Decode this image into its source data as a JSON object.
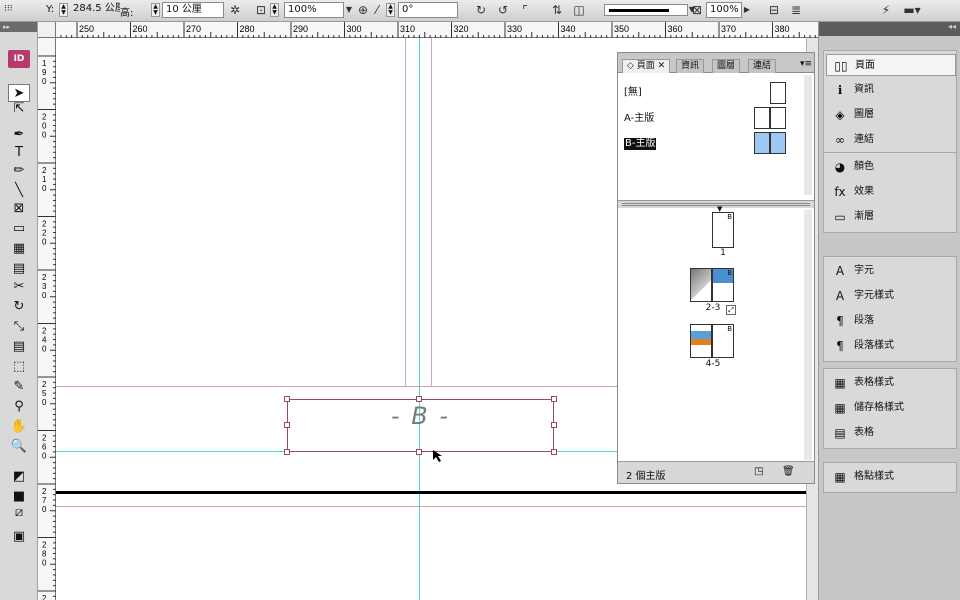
{
  "control_bar": {
    "ref_icon": "reference-point-icon",
    "y_label": "Y:",
    "y_value": "284.5 公厘",
    "h_label": "高:",
    "h_value": "10 公厘",
    "scale_x": "100%",
    "rotation": "0°",
    "stroke_weight": "100%"
  },
  "toolbox": {
    "logo": "ID",
    "tools": [
      "selection-tool-icon",
      "direct-selection-tool-icon",
      "pen-tool-icon",
      "type-tool-icon",
      "pencil-tool-icon",
      "line-tool-icon",
      "rectangle-frame-tool-icon",
      "rectangle-tool-icon",
      "table-tool-icon",
      "grid-tool-icon",
      "scissors-tool-icon",
      "rotate-tool-icon",
      "scale-tool-icon",
      "gradient-tool-icon",
      "free-transform-tool-icon",
      "note-tool-icon",
      "eyedropper-tool-icon",
      "hand-tool-icon",
      "zoom-tool-icon",
      "fill-stroke-icon",
      "apply-color-icon",
      "apply-none-icon",
      "view-mode-icon"
    ]
  },
  "ruler_top": [
    "250",
    "260",
    "270",
    "280",
    "290",
    "300",
    "310",
    "320",
    "330",
    "340",
    "350",
    "360",
    "370",
    "380"
  ],
  "ruler_left": [
    "1",
    "2",
    "2",
    "2",
    "2",
    "2",
    "2",
    "2",
    "2",
    "3",
    "3"
  ],
  "canvas": {
    "frame_text": "- B -"
  },
  "pages_panel": {
    "tabs": [
      "頁面",
      "資訊",
      "圖層",
      "連結"
    ],
    "masters": [
      {
        "label": "[無]"
      },
      {
        "label": "A-主版"
      },
      {
        "label": "B-主版"
      }
    ],
    "pages": [
      {
        "num": "1",
        "master_letter": "B"
      },
      {
        "num": "2-3",
        "master_letter": "B"
      },
      {
        "num": "4-5",
        "master_letter": "B"
      }
    ],
    "footer": "2 個主版"
  },
  "dock": {
    "groups": [
      [
        {
          "label": "頁面",
          "icon": "pages-icon"
        },
        {
          "label": "資訊",
          "icon": "info-icon"
        },
        {
          "label": "圖層",
          "icon": "layers-icon"
        },
        {
          "label": "連結",
          "icon": "links-icon"
        }
      ],
      [
        {
          "label": "顏色",
          "icon": "color-icon"
        },
        {
          "label": "效果",
          "icon": "effects-icon"
        },
        {
          "label": "漸層",
          "icon": "gradient-icon"
        }
      ],
      [
        {
          "label": "字元",
          "icon": "character-icon"
        },
        {
          "label": "字元樣式",
          "icon": "character-styles-icon"
        },
        {
          "label": "段落",
          "icon": "paragraph-icon"
        },
        {
          "label": "段落樣式",
          "icon": "paragraph-styles-icon"
        }
      ],
      [
        {
          "label": "表格樣式",
          "icon": "table-styles-icon"
        },
        {
          "label": "儲存格樣式",
          "icon": "cell-styles-icon"
        },
        {
          "label": "表格",
          "icon": "table-icon"
        }
      ],
      [
        {
          "label": "格點樣式",
          "icon": "grid-styles-icon"
        }
      ]
    ]
  }
}
